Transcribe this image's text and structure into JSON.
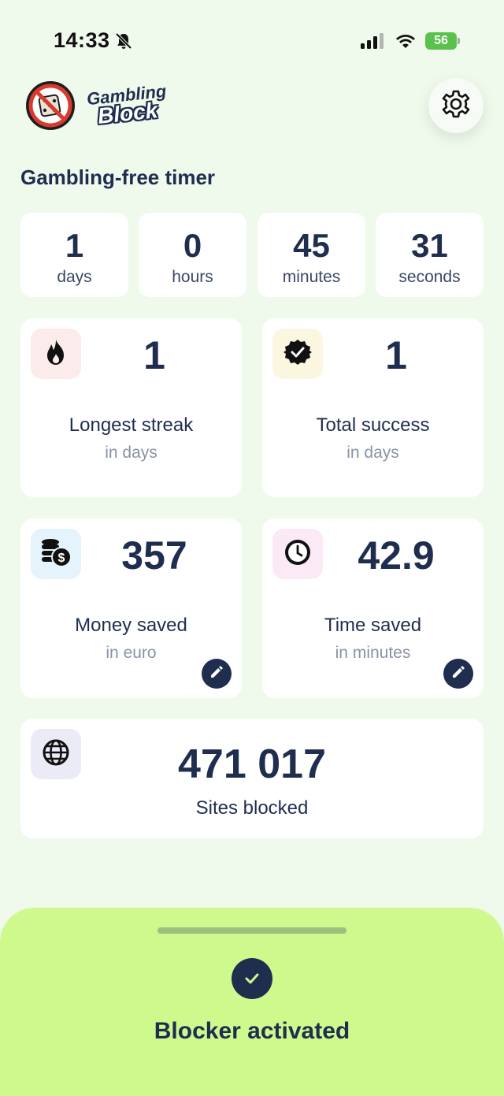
{
  "status_bar": {
    "time": "14:33",
    "battery": "56",
    "icons": [
      "bell-slash-icon",
      "signal-icon",
      "wifi-icon",
      "battery-icon"
    ]
  },
  "header": {
    "logo_line1": "Gambling",
    "logo_line2": "Block",
    "settings_icon": "gear-icon"
  },
  "timer": {
    "title": "Gambling-free timer",
    "units": [
      {
        "value": "1",
        "label": "days"
      },
      {
        "value": "0",
        "label": "hours"
      },
      {
        "value": "45",
        "label": "minutes"
      },
      {
        "value": "31",
        "label": "seconds"
      }
    ]
  },
  "stats": {
    "longest_streak": {
      "value": "1",
      "label": "Longest streak",
      "sub": "in days",
      "icon": "flame-icon",
      "icon_bg": "#fbeceb"
    },
    "total_success": {
      "value": "1",
      "label": "Total success",
      "sub": "in days",
      "icon": "verified-badge-icon",
      "icon_bg": "#fbf6e0"
    },
    "money_saved": {
      "value": "357",
      "label": "Money saved",
      "sub": "in euro",
      "icon": "coins-icon",
      "icon_bg": "#e5f4fc"
    },
    "time_saved": {
      "value": "42.9",
      "label": "Time saved",
      "sub": "in minutes",
      "icon": "clock-icon",
      "icon_bg": "#fbeaf6"
    },
    "sites_blocked": {
      "value": "471 017",
      "label": "Sites blocked",
      "icon": "globe-icon",
      "icon_bg": "#ebebf8"
    }
  },
  "bottom_sheet": {
    "status": "Blocker activated",
    "color": "#cdf98d"
  }
}
